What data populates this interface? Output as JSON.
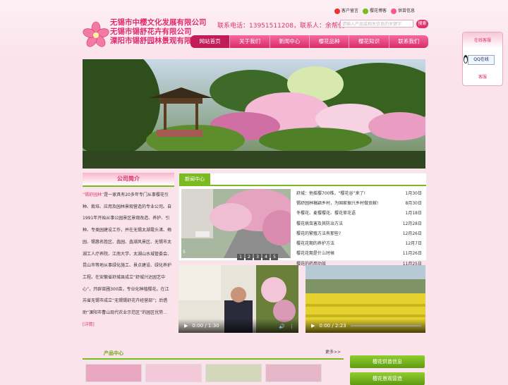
{
  "header": {
    "company_lines": [
      "无锡市中樱文化发展有限公司",
      "无锡市锡舒花卉有限公司",
      "溧阳市锡舒园林景观有限公司"
    ],
    "top_links": [
      "客户留言",
      "樱花博客",
      "供苗信息"
    ],
    "contact": "联系电话：13951511208，联系人：余帮俊",
    "search_placeholder": "请输入产品或相关信息的关键字",
    "search_button": "搜索"
  },
  "nav": [
    "网站首页",
    "关于我们",
    "新闻中心",
    "樱花品种",
    "樱花知识",
    "联系我们"
  ],
  "intro": {
    "title": "公司简介",
    "brand": "“锡舒园林”",
    "text": "是一家具有20多年专门从事樱花引种、栽培、应用及园林景观营造的专业公司。自1991年开始从事公园景区景观改造、养护、引种、专类园建设工作，并在无锡太湖鼋头渚、梅园、锡惠名胜区、蠡园、蠡湖风景区、无锡市太湖工人疗养院、江南大学、太湖山水城管委会、昆山市等地从事绿化施工、景点建设、绿化养护工程。在安徽省舒城县成立“舒城兴达园艺中心”，开辟苗圃300亩，专业化种植樱花。在江苏省无锡市成立“无锡锡舒花卉经营部”；后借助“溧阳市曹山现代农业示范区”的园区优势",
    "more": "…[详情]"
  },
  "news": {
    "tab": "新闻中心",
    "slide_num": "5",
    "pages": [
      "1",
      "2",
      "3",
      "4",
      "5"
    ],
    "items": [
      {
        "title": "舒城：他摇樱700株，“樱花谷”来了!",
        "date": "1月30日"
      },
      {
        "title": "锡舒园林稿颖乡村，为国家振兴乡村做贡献!",
        "date": "8月30日"
      },
      {
        "title": "冬樱花、麦樱樱花、樱花草花语",
        "date": "1月18日"
      },
      {
        "title": "樱花病虫害及其防治方法",
        "date": "12月28日"
      },
      {
        "title": "樱花的繁殖方法有那些?",
        "date": "12月26日"
      },
      {
        "title": "樱花花期的养护方法",
        "date": "12月7日"
      },
      {
        "title": "樱花花期是什么时候",
        "date": "11月26日"
      },
      {
        "title": "樱花的药用功效",
        "date": "11月25日"
      }
    ]
  },
  "videos": [
    {
      "time": "0:00 / 1:30"
    },
    {
      "time": "0:00 / 2:23"
    }
  ],
  "products": {
    "title": "产品中心",
    "more": "更多>>"
  },
  "side_buttons": [
    "樱花供苗信息",
    "樱花景观营造"
  ],
  "qq": {
    "title": "在线客服",
    "button": "QQ在线",
    "footer": "客服"
  },
  "colors": {
    "brand": "#e0286a",
    "accent_green": "#7cba21"
  }
}
